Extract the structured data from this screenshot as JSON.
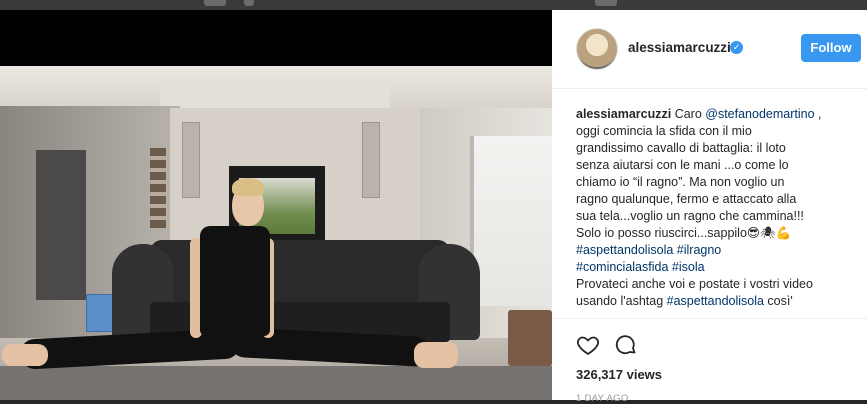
{
  "post": {
    "username": "alessiamarcuzzi",
    "follow_label": "Follow",
    "caption": {
      "author": "alessiamarcuzzi",
      "lines": [
        {
          "pre": "Caro ",
          "link": "@stefanodemartino",
          "post": " ,"
        },
        {
          "text": "oggi comincia la sfida con il mio"
        },
        {
          "text": "grandissimo cavallo di battaglia: il loto"
        },
        {
          "text": "senza aiutarsi con le mani ...o come lo"
        },
        {
          "text": "chiamo io “il ragno”. Ma non voglio un"
        },
        {
          "text": "ragno qualunque, fermo e attaccato alla"
        },
        {
          "text": "sua tela...voglio un ragno che cammina!!!"
        },
        {
          "text": "Solo io posso riuscirci...sappilo😎🕷💪"
        },
        {
          "hashtags": [
            "#aspettandolisola",
            "#ilragno"
          ]
        },
        {
          "hashtags": [
            "#comincialasfida",
            "#isola"
          ]
        },
        {
          "text": "Provateci anche voi e postate i vostri video"
        },
        {
          "pre": "usando l'ashtag ",
          "link": "#aspettandolisola",
          "post": " così'"
        }
      ]
    },
    "views": "326,317 views",
    "time": "1 DAY AGO"
  },
  "icons": {
    "heart": "heart-icon",
    "comment": "comment-icon",
    "verified": "verified-badge-icon"
  },
  "colors": {
    "follow_button": "#3897f0",
    "link": "#003569",
    "text": "#262626",
    "muted": "#999999"
  }
}
